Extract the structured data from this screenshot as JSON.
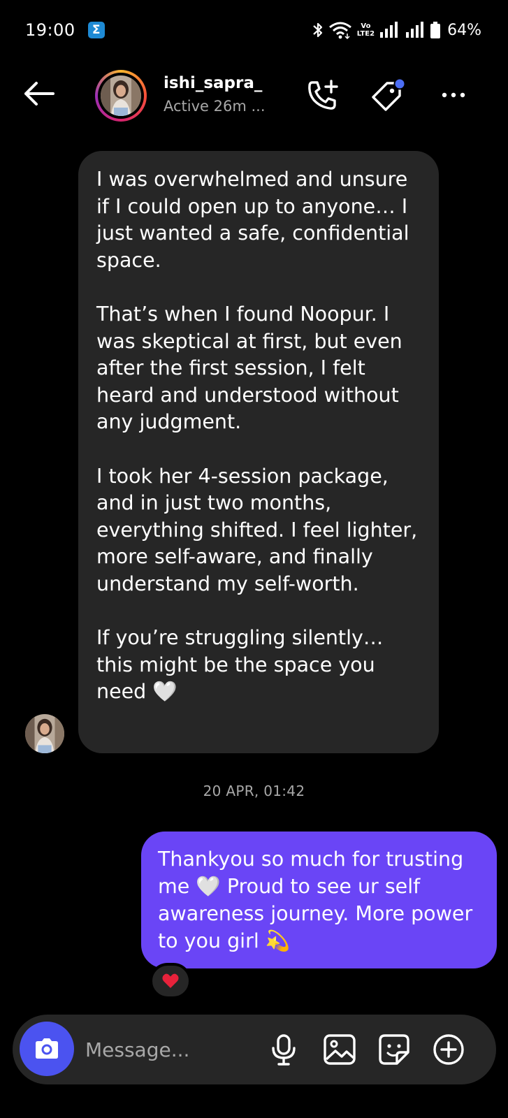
{
  "status_bar": {
    "time": "19:00",
    "app_badge": "Σ",
    "network_label_top": "Vo",
    "network_label_bottom": "LTE2",
    "battery": "64%"
  },
  "header": {
    "username": "ishi_sapra_",
    "active_status": "Active 26m ..."
  },
  "messages": {
    "incoming_paragraphs": [
      "I was overwhelmed and unsure if I could open up to anyone… I just wanted a safe, confidential space.",
      "That’s when I found Noopur. I was skeptical at first, but even after the first session, I felt heard and understood without any judgment.",
      "I took her 4-session package, and in just two months, everything shifted. I feel lighter, more self-aware, and finally understand my self-worth.",
      "If you’re struggling silently… this might be the space you need 🤍"
    ],
    "timestamp": "20 APR, 01:42",
    "outgoing": "Thankyou so much for trusting me 🤍 Proud to see ur self awareness journey. More power to you girl 💫",
    "reaction": "❤️"
  },
  "composer": {
    "placeholder": "Message..."
  },
  "colors": {
    "background": "#000000",
    "incoming_bubble": "#262626",
    "outgoing_bubble": "#6a45f6",
    "camera_button": "#4b53f0",
    "tag_dot": "#4c6ef5"
  },
  "icons": [
    "back-arrow-icon",
    "phone-add-icon",
    "tag-icon",
    "more-icon",
    "camera-icon",
    "microphone-icon",
    "gallery-icon",
    "sticker-icon",
    "plus-circle-icon",
    "bluetooth-icon",
    "wifi-icon",
    "signal-icon",
    "battery-icon"
  ]
}
